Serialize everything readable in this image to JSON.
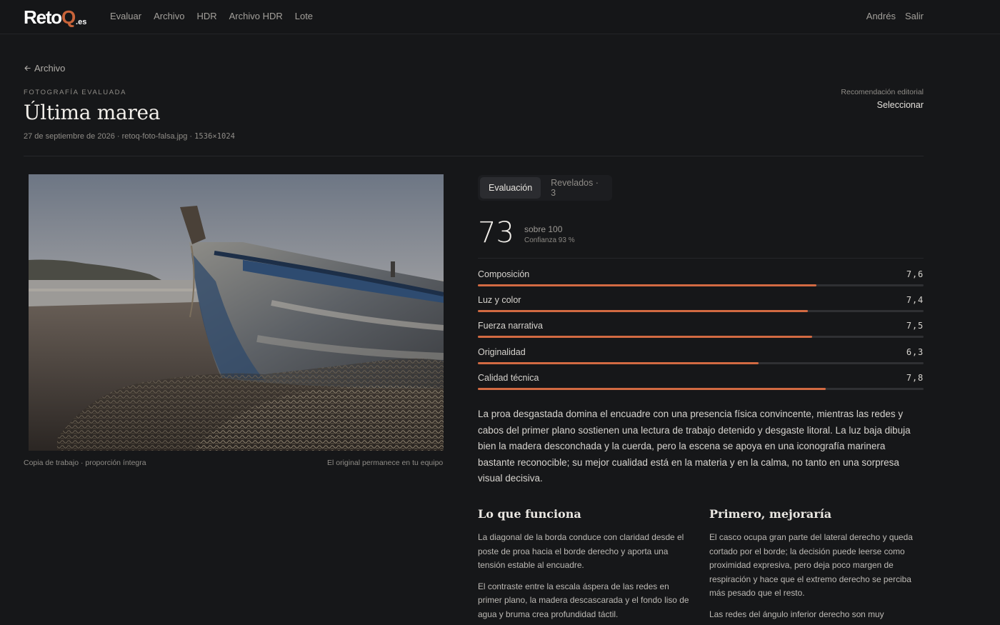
{
  "brand": {
    "name_main": "Reto",
    "name_q": "Q",
    "name_suffix": ".es"
  },
  "nav": {
    "items": [
      "Evaluar",
      "Archivo",
      "HDR",
      "Archivo HDR",
      "Lote"
    ]
  },
  "user": {
    "name": "Andrés",
    "logout": "Salir"
  },
  "back": {
    "label": "Archivo"
  },
  "header": {
    "eyebrow": "FOTOGRAFÍA EVALUADA",
    "title": "Última marea",
    "date": "27 de septiembre de 2026",
    "filename": "retoq-foto-falsa.jpg",
    "dimensions": "1536×1024",
    "recommendation_label": "Recomendación editorial",
    "recommendation_value": "Seleccionar"
  },
  "photo": {
    "caption_left": "Copia de trabajo · proporción íntegra",
    "caption_right": "El original permanece en tu equipo"
  },
  "tabs": {
    "evaluation": "Evaluación",
    "developments": "Revelados · 3"
  },
  "score": {
    "value": "73",
    "out_of": "sobre 100",
    "confidence": "Confianza 93 %"
  },
  "criteria": [
    {
      "label": "Composición",
      "value_text": "7,6",
      "value": 7.6
    },
    {
      "label": "Luz y color",
      "value_text": "7,4",
      "value": 7.4
    },
    {
      "label": "Fuerza narrativa",
      "value_text": "7,5",
      "value": 7.5
    },
    {
      "label": "Originalidad",
      "value_text": "6,3",
      "value": 6.3
    },
    {
      "label": "Calidad técnica",
      "value_text": "7,8",
      "value": 7.8
    }
  ],
  "summary": "La proa desgastada domina el encuadre con una presencia física convincente, mientras las redes y cabos del primer plano sostienen una lectura de trabajo detenido y desgaste litoral. La luz baja dibuja bien la madera desconchada y la cuerda, pero la escena se apoya en una iconografía marinera bastante reconocible; su mejor cualidad está en la materia y en la calma, no tanto en una sorpresa visual decisiva.",
  "works": {
    "title": "Lo que funciona",
    "paragraphs": [
      "La diagonal de la borda conduce con claridad desde el poste de proa hacia el borde derecho y aporta una tensión estable al encuadre.",
      "El contraste entre la escala áspera de las redes en primer plano, la madera descascarada y el fondo liso de agua y bruma crea profundidad táctil."
    ]
  },
  "improve": {
    "title": "Primero, mejoraría",
    "paragraphs": [
      "El casco ocupa gran parte del lateral derecho y queda cortado por el borde; la decisión puede leerse como proximidad expresiva, pero deja poco margen de respiración y hace que el extremo derecho se perciba más pesado que el resto.",
      "Las redes del ángulo inferior derecho son muy"
    ]
  },
  "colors": {
    "accent": "#d26a42",
    "background": "#161719"
  }
}
